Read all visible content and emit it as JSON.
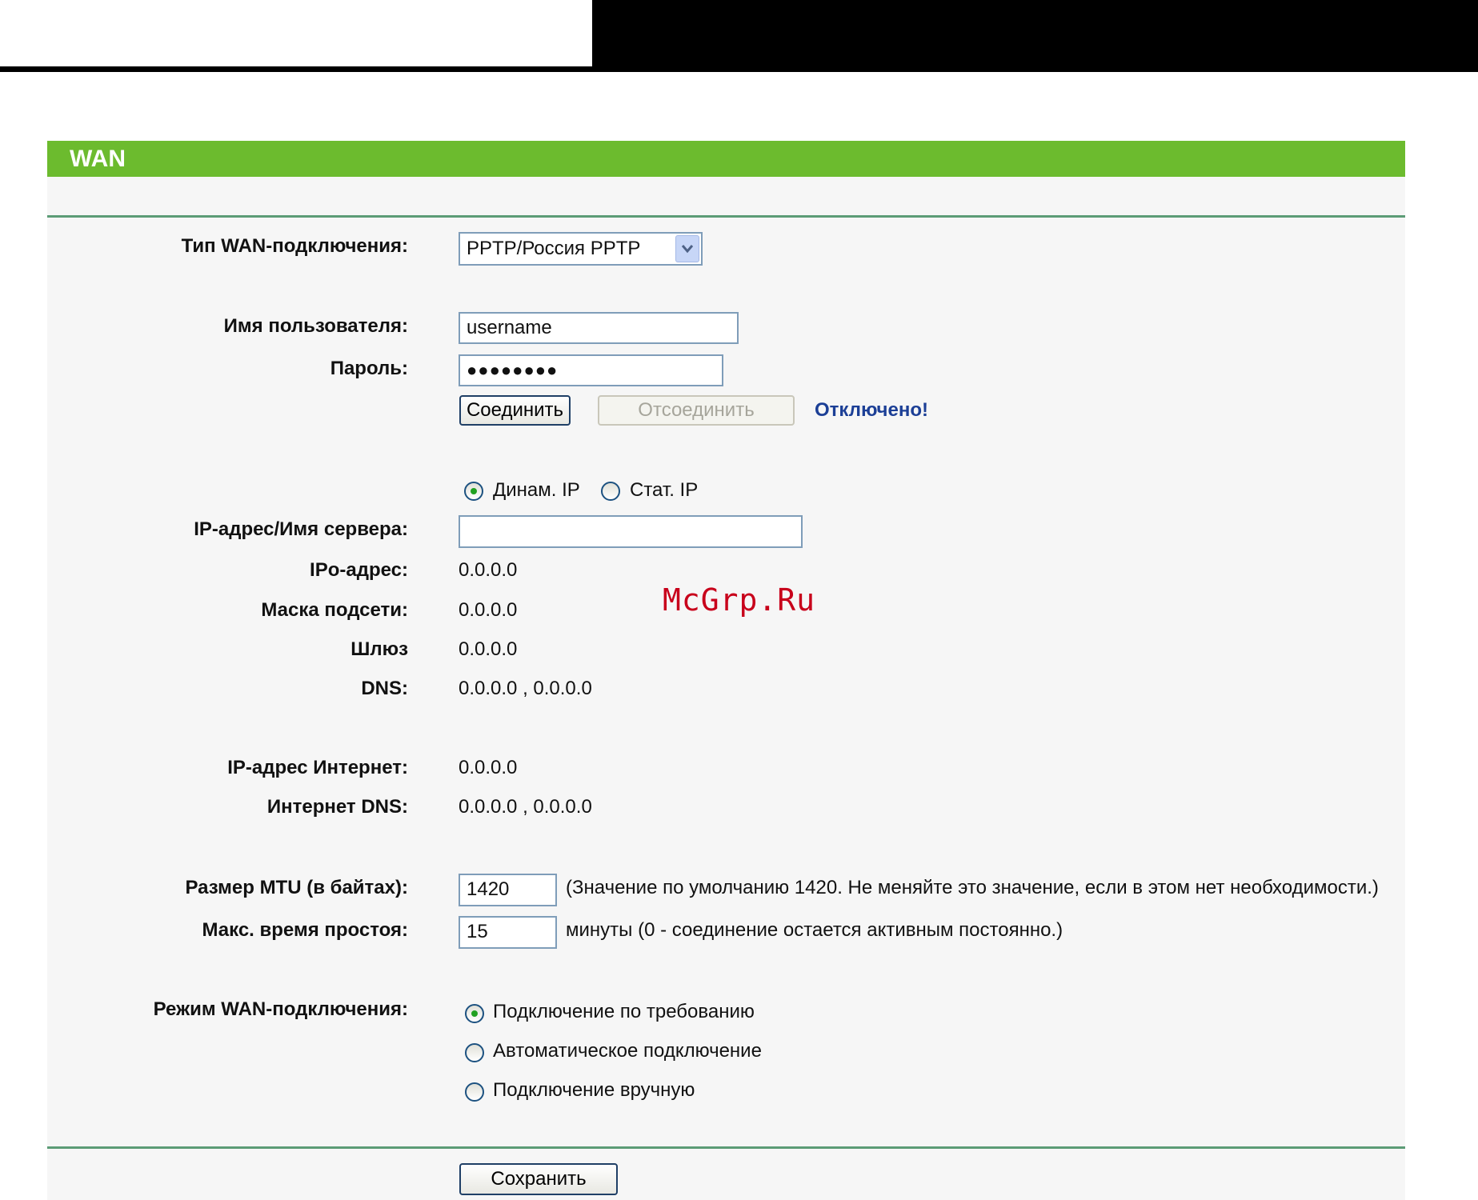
{
  "header": {
    "title": "WAN"
  },
  "form": {
    "wan_type": {
      "label": "Тип WAN-подключения:",
      "selected": "PPTP/Россия PPTP"
    },
    "username": {
      "label": "Имя пользователя:",
      "value": "username"
    },
    "password": {
      "label": "Пароль:",
      "value": "●●●●●●●●"
    },
    "connect_label": "Соединить",
    "disconnect_label": "Отсоединить",
    "status": "Отключено!",
    "ip_mode": {
      "dynamic_label": "Динам. IP",
      "static_label": "Стат. IP"
    },
    "server": {
      "label": "IP-адрес/Имя сервера:",
      "value": ""
    },
    "ip_address": {
      "label": "IPо-адрес:",
      "value": "0.0.0.0"
    },
    "subnet_mask": {
      "label": "Маска подсети:",
      "value": "0.0.0.0"
    },
    "gateway": {
      "label": "Шлюз",
      "value": "0.0.0.0"
    },
    "dns": {
      "label": "DNS:",
      "value": "0.0.0.0 , 0.0.0.0"
    },
    "internet_ip": {
      "label": "IP-адрес Интернет:",
      "value": "0.0.0.0"
    },
    "internet_dns": {
      "label": "Интернет DNS:",
      "value": "0.0.0.0 , 0.0.0.0"
    },
    "mtu": {
      "label": "Размер MTU (в байтах):",
      "value": "1420",
      "note": "(Значение по умолчанию 1420. Не меняйте это значение, если в этом нет необходимости.)"
    },
    "idle_time": {
      "label": "Макс. время простоя:",
      "value": "15",
      "note": "минуты (0 - соединение остается активным постоянно.)"
    },
    "wan_mode": {
      "label": "Режим WAN-подключения:",
      "options": [
        "Подключение по требованию",
        "Автоматическое подключение",
        "Подключение вручную"
      ]
    },
    "save_label": "Сохранить"
  },
  "watermark": "McGrp.Ru",
  "colors": {
    "header_green": "#6cbb2e",
    "rule_green": "#5c9c76",
    "status_blue": "#1c3f96",
    "watermark_red": "#c8001b"
  }
}
